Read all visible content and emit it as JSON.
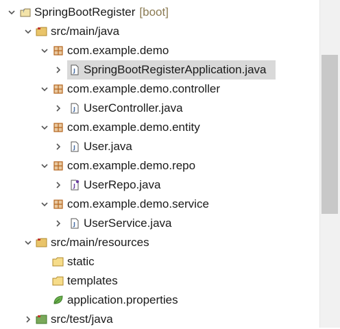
{
  "project": {
    "name": "SpringBootRegister",
    "tag": "[boot]"
  },
  "main_java": {
    "label": "src/main/java",
    "packages": [
      {
        "label": "com.example.demo",
        "file": "SpringBootRegisterApplication.java"
      },
      {
        "label": "com.example.demo.controller",
        "file": "UserController.java"
      },
      {
        "label": "com.example.demo.entity",
        "file": "User.java"
      },
      {
        "label": "com.example.demo.repo",
        "file": "UserRepo.java"
      },
      {
        "label": "com.example.demo.service",
        "file": "UserService.java"
      }
    ]
  },
  "main_resources": {
    "label": "src/main/resources",
    "children": [
      {
        "label": "static"
      },
      {
        "label": "templates"
      },
      {
        "label": "application.properties"
      }
    ]
  },
  "test_java": {
    "label": "src/test/java"
  },
  "colors": {
    "folder": "#e9c46a",
    "package": "#b5651d",
    "selected_bg": "#d9d9d9",
    "boot_tag": "#8a7a52",
    "leaf": "#6ab04c"
  }
}
